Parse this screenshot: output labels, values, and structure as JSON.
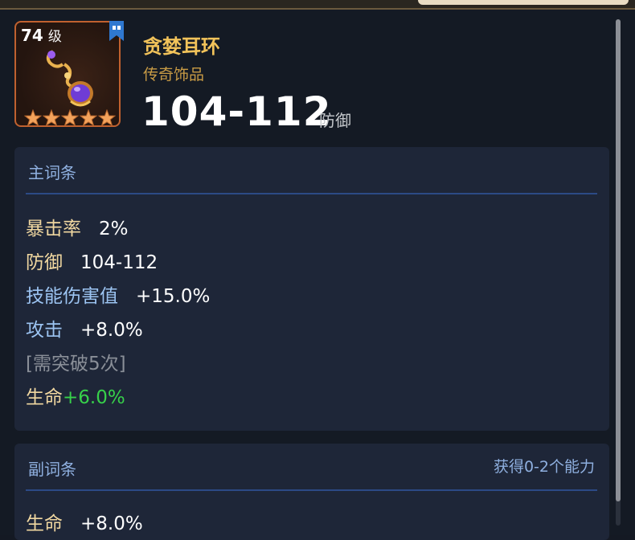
{
  "item": {
    "level_number": "74",
    "level_unit": "级",
    "name": "贪婪耳环",
    "type": "传奇饰品",
    "value": "104-112",
    "value_unit": "防御",
    "stars": 5
  },
  "main_stats": {
    "title": "主词条",
    "rows": [
      {
        "label": "暴击率",
        "value": "2%"
      },
      {
        "label": "防御",
        "value": "104-112"
      },
      {
        "label": "技能伤害值",
        "value": "+15.0%"
      },
      {
        "label": "攻击",
        "value": "+8.0%"
      }
    ],
    "note": "[需突破5次]",
    "locked": {
      "label": "生命",
      "value": "+6.0%"
    }
  },
  "sub_stats": {
    "title": "副词条",
    "aside": "获得0-2个能力",
    "rows": [
      {
        "label": "生命",
        "value": "+8.0%"
      }
    ]
  },
  "colors": {
    "name_gold": "#f2c35a",
    "stat_label_gold": "#f0d7a0",
    "stat_label_blue": "#9cc4f2",
    "bonus_green": "#37d14a",
    "section_bg": "#1e2638",
    "divider_blue": "#2c4a86",
    "frame_orange": "#c0612f"
  },
  "icons": {
    "bookmark": "bookmark-icon",
    "earring": "earring-icon",
    "star": "star-icon"
  }
}
